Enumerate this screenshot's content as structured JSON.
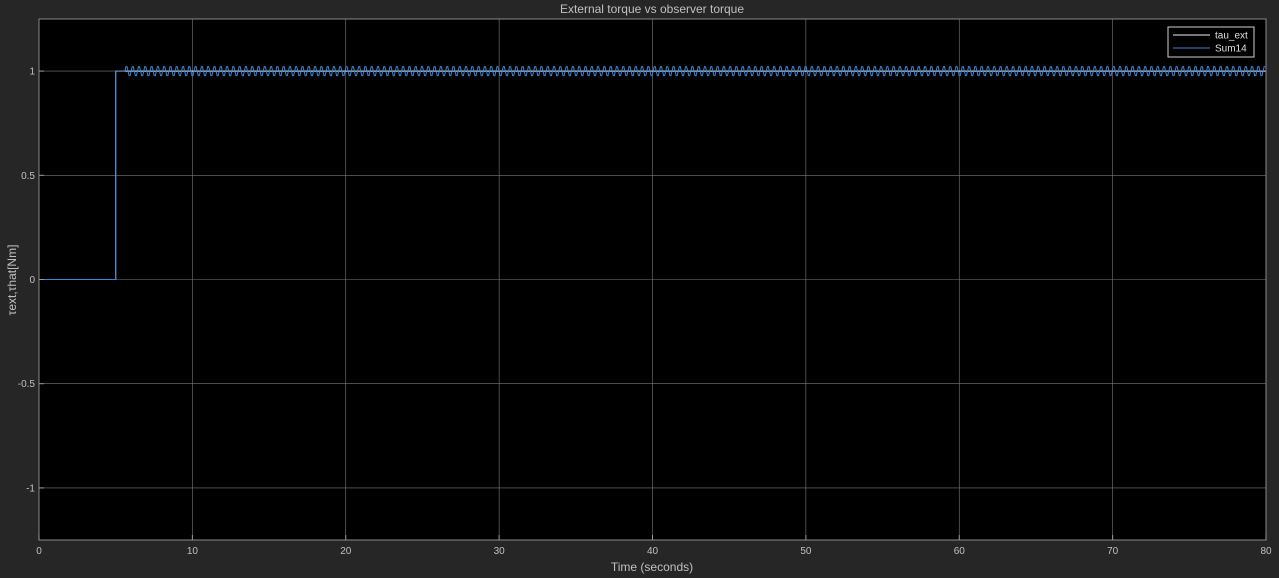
{
  "window": {
    "background": "#262626"
  },
  "chart_data": {
    "type": "line",
    "title": "External torque vs observer torque",
    "xlabel": "Time (seconds)",
    "ylabel": "τext,τhat[Nm]",
    "xlim": [
      0,
      80
    ],
    "ylim": [
      -1.25,
      1.25
    ],
    "xticks": [
      0,
      10,
      20,
      30,
      40,
      50,
      60,
      70,
      80
    ],
    "xtick_labels": [
      "0",
      "10",
      "20",
      "30",
      "40",
      "50",
      "60",
      "70",
      "80"
    ],
    "yticks": [
      -1,
      -0.5,
      0,
      0.5,
      1
    ],
    "ytick_labels": [
      "-1",
      "-0.5",
      "0",
      "0.5",
      "1"
    ],
    "grid": true,
    "legend_position": "top-right",
    "colors": {
      "axes_bg": "#000000",
      "grid": "#7a7a7a",
      "text": "#c0c0c0",
      "tau_ext": "#f0f0f0",
      "Sum14": "#3a86d8"
    },
    "series": [
      {
        "name": "tau_ext",
        "x": [
          0,
          5,
          5,
          80
        ],
        "y": [
          0,
          0,
          1,
          1
        ]
      },
      {
        "name": "Sum14",
        "x": [
          0,
          0,
          0.05,
          5,
          5,
          5.6
        ],
        "y": [
          -1.25,
          0,
          0,
          0,
          1,
          1
        ],
        "oscillation": {
          "from": 5.6,
          "to": 80,
          "center": 1,
          "amplitude": 0.025,
          "period": 0.41
        }
      }
    ]
  }
}
